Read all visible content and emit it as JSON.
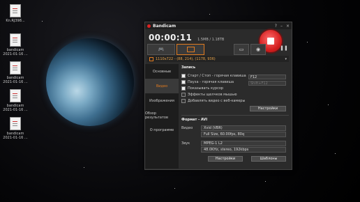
{
  "desktop": {
    "icons": [
      {
        "label": "Kn.RJ398..."
      },
      {
        "label": "bandicam 2021-01-16 ..."
      },
      {
        "label": "bandicam 2021-01-16 ..."
      },
      {
        "label": "bandicam 2021-01-16 ..."
      },
      {
        "label": "bandicam 2021-01-16 ..."
      }
    ]
  },
  "window": {
    "title": "Bandicam",
    "controls": {
      "help": "?",
      "minimize": "–",
      "close": "×"
    },
    "timer": "00:00:11",
    "size_info": "1.5MB / 1.18TB",
    "area_text": "1110x722 - (88, 214), (1178, 936)",
    "sidebar": [
      {
        "label": "Основные"
      },
      {
        "label": "Видео"
      },
      {
        "label": "Изображения"
      },
      {
        "label": "Обзор результатов"
      },
      {
        "label": "О программе"
      }
    ],
    "record": {
      "title": "Запись",
      "start_stop_label": "Старт / Стоп - горячая клавиша",
      "start_stop_key": "F12",
      "pause_label": "Пауза - горячая клавиша",
      "pause_key": "Shift+F12",
      "show_cursor": "Показывать курсор",
      "click_effects": "Эффекты щелчков мышью",
      "webcam": "Добавлять видео с веб-камеры",
      "settings_button": "Настройки"
    },
    "format": {
      "title": "Формат - AVI",
      "video_label": "Видео",
      "video_codec": "Xvid (VBR)",
      "video_params": "Full Size, 60.00fps, 80q",
      "audio_label": "Звук",
      "audio_codec": "MPEG-1 L2",
      "audio_params": "48.0KHz, stereo, 192kbps",
      "settings_button": "Настройки",
      "templates_button": "Шаблоны"
    },
    "colors": {
      "accent": "#e07b20",
      "record": "#d41f1f"
    }
  }
}
